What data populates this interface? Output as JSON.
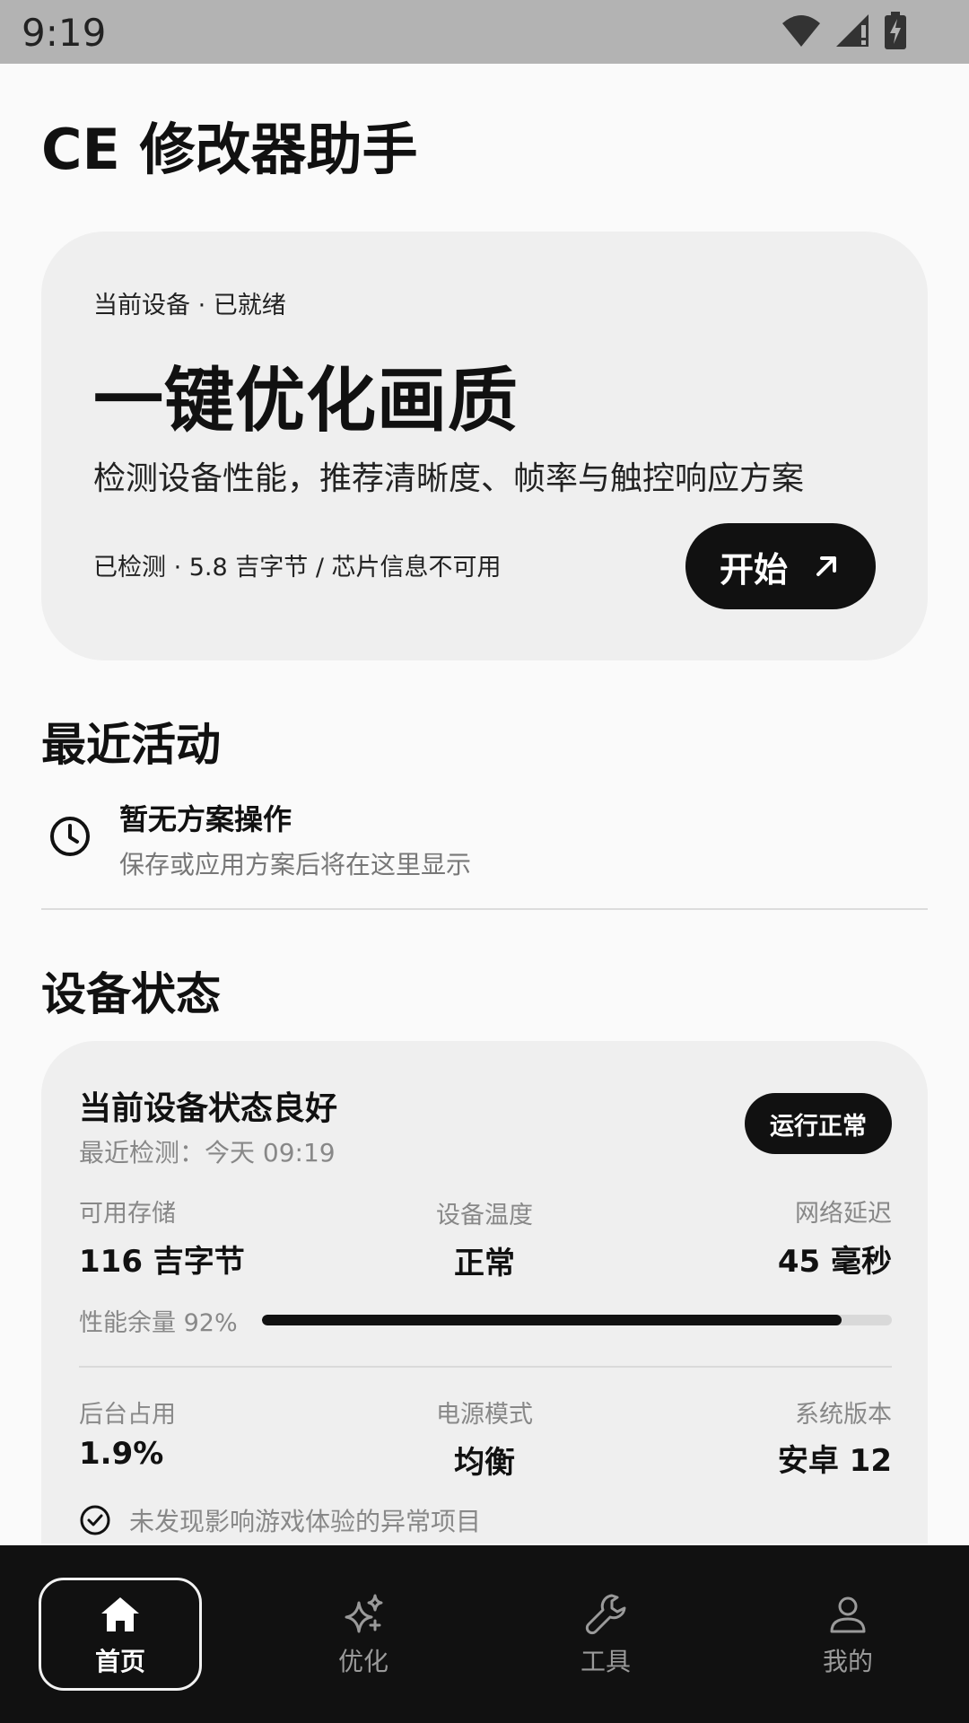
{
  "status_bar": {
    "time": "9:19"
  },
  "app": {
    "title": "CE 修改器助手"
  },
  "hero": {
    "subtitle": "当前设备 · 已就绪",
    "title": "一键优化画质",
    "description": "检测设备性能，推荐清晰度、帧率与触控响应方案",
    "meta": "已检测 · 5.8 吉字节 / 芯片信息不可用",
    "start_label": "开始"
  },
  "recent": {
    "section_title": "最近活动",
    "empty_title": "暂无方案操作",
    "empty_subtitle": "保存或应用方案后将在这里显示"
  },
  "device_status": {
    "section_title": "设备状态",
    "heading": "当前设备状态良好",
    "last_check": "最近检测：今天 09:19",
    "badge": "运行正常",
    "metrics_row1": [
      {
        "label": "可用存储",
        "value": "116 吉字节"
      },
      {
        "label": "设备温度",
        "value": "正常"
      },
      {
        "label": "网络延迟",
        "value": "45 毫秒"
      }
    ],
    "performance": {
      "label": "性能余量 92%",
      "percent": 92
    },
    "metrics_row2": [
      {
        "label": "后台占用",
        "value": "1.9%"
      },
      {
        "label": "电源模式",
        "value": "均衡"
      },
      {
        "label": "系统版本",
        "value": "安卓 12"
      }
    ],
    "check_message": "未发现影响游戏体验的异常项目"
  },
  "nav": {
    "items": [
      {
        "label": "首页",
        "icon": "home-icon",
        "active": true
      },
      {
        "label": "优化",
        "icon": "sparkle-icon",
        "active": false
      },
      {
        "label": "工具",
        "icon": "wrench-icon",
        "active": false
      },
      {
        "label": "我的",
        "icon": "person-icon",
        "active": false
      }
    ]
  }
}
